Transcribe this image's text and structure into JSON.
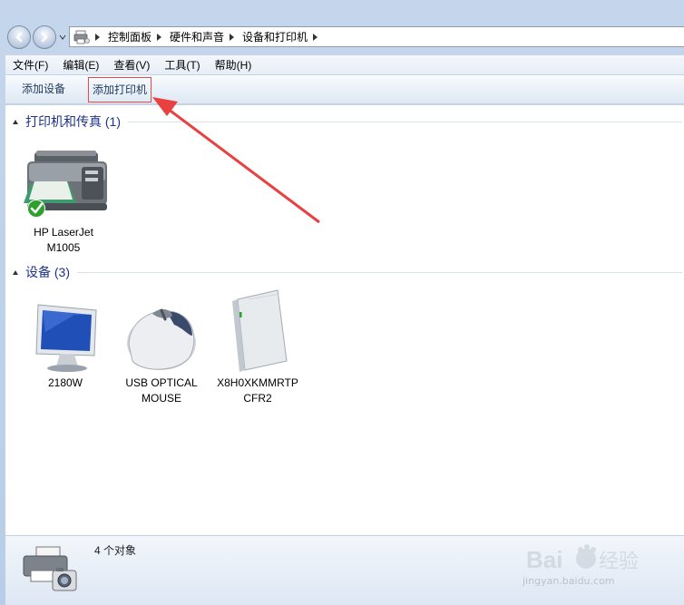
{
  "address_bar": {
    "crumbs": [
      "控制面板",
      "硬件和声音",
      "设备和打印机"
    ]
  },
  "menu": [
    "文件(F)",
    "编辑(E)",
    "查看(V)",
    "工具(T)",
    "帮助(H)"
  ],
  "toolbar": {
    "add_device": "添加设备",
    "add_printer": "添加打印机"
  },
  "groups": {
    "printers": {
      "title": "打印机和传真 (1)",
      "items": [
        {
          "line1": "HP LaserJet",
          "line2": "M1005"
        }
      ]
    },
    "devices": {
      "title": "设备 (3)",
      "items": [
        {
          "line1": "2180W",
          "line2": ""
        },
        {
          "line1": "USB OPTICAL",
          "line2": "MOUSE"
        },
        {
          "line1": "X8H0XKMMRTP",
          "line2": "CFR2"
        }
      ]
    }
  },
  "details": {
    "count": "4 个对象"
  },
  "watermark": {
    "brand": "Baidu 经验",
    "url": "jingyan.baidu.com"
  },
  "colors": {
    "annotation": "#e94040",
    "group_title": "#1e3287",
    "status_ok": "#2ea02e"
  }
}
